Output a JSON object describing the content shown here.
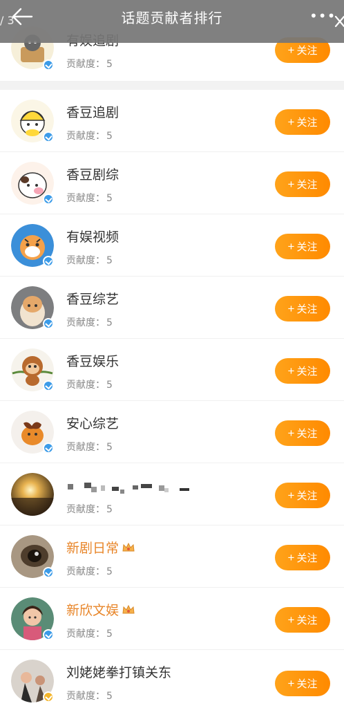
{
  "header": {
    "counter": "/ 3",
    "title": "话题贡献者排行",
    "more": "•••"
  },
  "icons": {
    "back": "arrow-left-icon",
    "more": "more-horizontal-icon",
    "close": "close-icon",
    "verified": "verified-badge-icon",
    "crown": "crown-icon"
  },
  "colors": {
    "accent": "#ff9600",
    "verified_blue": "#3b9be8",
    "verified_gold": "#f4b52a",
    "highlight_name": "#e8862a"
  },
  "follow_label": "关注",
  "score_label": "贡献度：",
  "rows": [
    {
      "name": "有娱追剧",
      "score": "5",
      "highlight": false,
      "badge": "blue"
    },
    {
      "name": "香豆追剧",
      "score": "5",
      "highlight": false,
      "badge": "blue"
    },
    {
      "name": "香豆剧综",
      "score": "5",
      "highlight": false,
      "badge": "blue"
    },
    {
      "name": "有娱视频",
      "score": "5",
      "highlight": false,
      "badge": "blue"
    },
    {
      "name": "香豆综艺",
      "score": "5",
      "highlight": false,
      "badge": "blue"
    },
    {
      "name": "香豆娱乐",
      "score": "5",
      "highlight": false,
      "badge": "blue"
    },
    {
      "name": "安心综艺",
      "score": "5",
      "highlight": false,
      "badge": "blue"
    },
    {
      "name": "",
      "score": "5",
      "highlight": false,
      "badge": "none"
    },
    {
      "name": "新剧日常",
      "score": "5",
      "highlight": true,
      "badge": "blue"
    },
    {
      "name": "新欣文娱",
      "score": "5",
      "highlight": true,
      "badge": "blue"
    },
    {
      "name": "刘姥姥拳打镇关东",
      "score": "5",
      "highlight": false,
      "badge": "gold"
    }
  ]
}
